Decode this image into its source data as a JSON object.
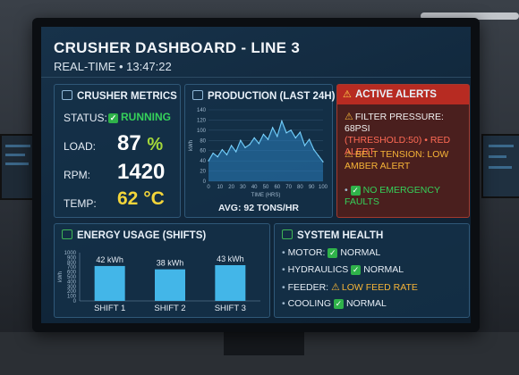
{
  "dashboard": {
    "title": "CRUSHER DASHBOARD - LINE 3",
    "subtitle": "REAL-TIME • 13:47:22"
  },
  "metrics": {
    "title": "CRUSHER METRICS",
    "status_label": "STATUS:",
    "status_value": "RUNNING",
    "load_label": "LOAD:",
    "load_value": "87",
    "load_unit": "%",
    "rpm_label": "RPM:",
    "rpm_value": "1420",
    "temp_label": "TEMP:",
    "temp_value": "62 °C"
  },
  "production": {
    "title": "PRODUCTION (LAST 24H)",
    "avg_text": "AVG: 92 TONS/HR"
  },
  "alerts": {
    "title": "ACTIVE ALERTS",
    "items": [
      {
        "line1": "FILTER PRESSURE: 68PSI",
        "line2": "(THRESHOLD:50) • RED ALERT"
      },
      {
        "line1": "BELT TENSION: LOW",
        "line2": "AMBER ALERT"
      },
      {
        "line1": "NO EMERGENCY FAULTS"
      }
    ]
  },
  "energy": {
    "title": "ENERGY USAGE (SHIFTS)"
  },
  "health": {
    "title": "SYSTEM HEALTH",
    "items": [
      {
        "label": "MOTOR:",
        "status": "NORMAL",
        "state": "ok"
      },
      {
        "label": "HYDRAULICS",
        "status": "NORMAL",
        "state": "ok"
      },
      {
        "label": "FEEDER:",
        "status": "LOW FEED RATE",
        "state": "warn"
      },
      {
        "label": "COOLING",
        "status": "NORMAL",
        "state": "ok"
      }
    ]
  },
  "colors": {
    "ok": "#2fb24a",
    "warn": "#f6b437",
    "alert": "#b72b22",
    "accent": "#4fb4e8"
  },
  "chart_data": [
    {
      "type": "area",
      "title": "PRODUCTION (LAST 24H)",
      "xlabel": "TIME (HRS)",
      "ylabel": "kWh",
      "xlim": [
        0,
        100
      ],
      "ylim": [
        0,
        140
      ],
      "x_ticks": [
        0,
        10,
        20,
        30,
        40,
        50,
        60,
        70,
        80,
        90,
        100
      ],
      "y_ticks": [
        0,
        20,
        40,
        60,
        80,
        100,
        120,
        140
      ],
      "x": [
        0,
        4,
        8,
        12,
        16,
        20,
        24,
        28,
        32,
        36,
        40,
        44,
        48,
        52,
        56,
        60,
        64,
        68,
        72,
        76,
        80,
        84,
        88,
        92,
        96,
        100
      ],
      "y": [
        40,
        55,
        48,
        62,
        52,
        70,
        58,
        80,
        66,
        72,
        85,
        74,
        92,
        82,
        105,
        88,
        118,
        95,
        100,
        85,
        96,
        70,
        82,
        62,
        50,
        38
      ]
    },
    {
      "type": "bar",
      "title": "ENERGY USAGE (SHIFTS)",
      "ylabel": "kWh",
      "ylim": [
        0,
        1000
      ],
      "y_ticks": [
        0,
        100,
        200,
        300,
        400,
        500,
        600,
        700,
        800,
        900,
        1000
      ],
      "categories": [
        "SHIFT 1",
        "SHIFT 2",
        "SHIFT 3"
      ],
      "values": [
        42,
        38,
        43
      ],
      "data_labels": [
        "42 kWh",
        "38 kWh",
        "43 kWh"
      ]
    }
  ]
}
